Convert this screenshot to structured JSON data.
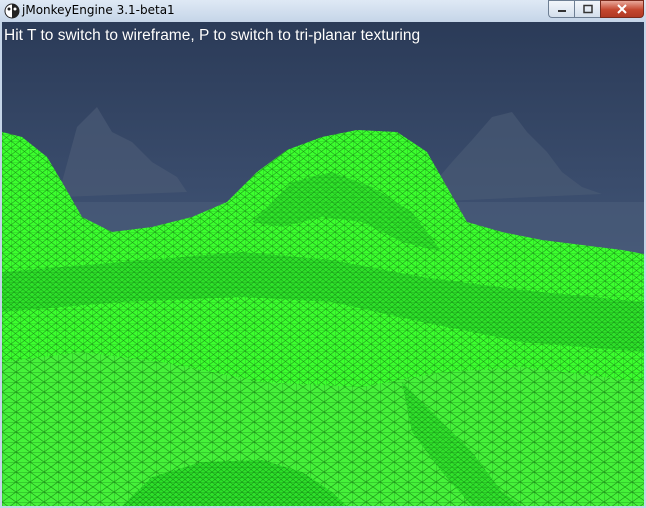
{
  "window": {
    "title": "jMonkeyEngine 3.1-beta1",
    "controls": {
      "minimize": "minimize-icon",
      "maximize": "maximize-icon",
      "close": "close-icon"
    }
  },
  "scene": {
    "hint": "Hit T to switch to wireframe,  P to switch to tri-planar texturing",
    "wireframe_color": "#00ff00",
    "sky_color": "#3d506f"
  }
}
